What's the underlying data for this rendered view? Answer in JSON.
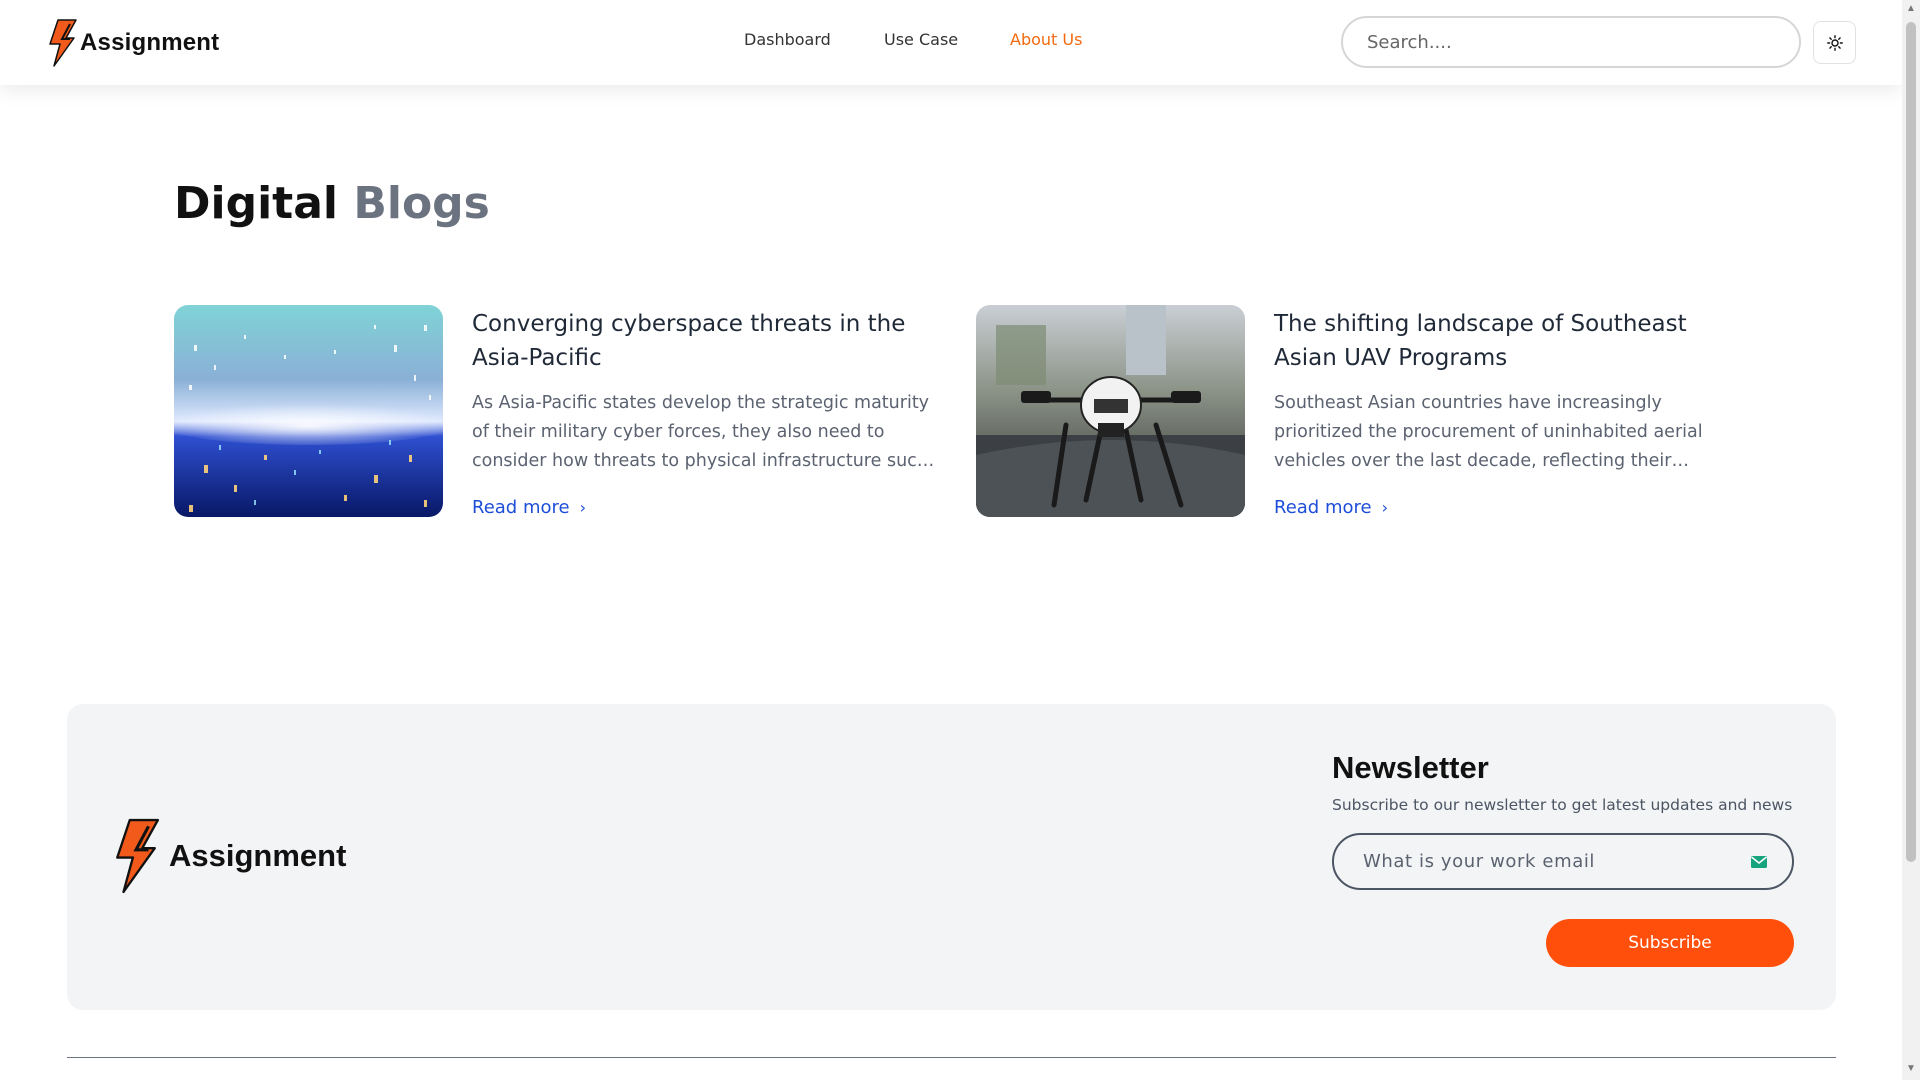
{
  "header": {
    "brand": "Assignment",
    "nav": [
      {
        "label": "Dashboard",
        "active": false
      },
      {
        "label": "Use Case",
        "active": false
      },
      {
        "label": "About Us",
        "active": true
      }
    ],
    "search_placeholder": "Search....",
    "theme_icon": "sun-icon"
  },
  "main": {
    "title_primary": "Digital",
    "title_accent": "Blogs",
    "posts": [
      {
        "title": "Converging cyberspace threats in the Asia-Pacific",
        "excerpt": "As Asia-Pacific states develop the strategic maturity of their military cyber forces, they also need to consider how threats to physical infrastructure such as undersea cables intersect with the cyber domain.",
        "read_more": "Read more",
        "image": "cyberspace-tunnel-image"
      },
      {
        "title": "The shifting landscape of Southeast Asian UAV Programs",
        "excerpt": "Southeast Asian countries have increasingly prioritized the procurement of uninhabited aerial vehicles over the last decade, reflecting their growing interest in unmanned capabilities.",
        "read_more": "Read more",
        "image": "drone-image"
      }
    ]
  },
  "footer": {
    "brand": "Assignment",
    "newsletter_title": "Newsletter",
    "newsletter_subtitle": "Subscribe to our newsletter to get latest updates and news",
    "email_placeholder": "What is your work email",
    "subscribe_label": "Subscribe"
  },
  "colors": {
    "accent_orange": "#f26a10",
    "subscribe_orange": "#ff4f0a",
    "link_blue": "#1d4ed8",
    "title_gray": "#6b7280",
    "footer_bg": "#f3f4f6"
  }
}
